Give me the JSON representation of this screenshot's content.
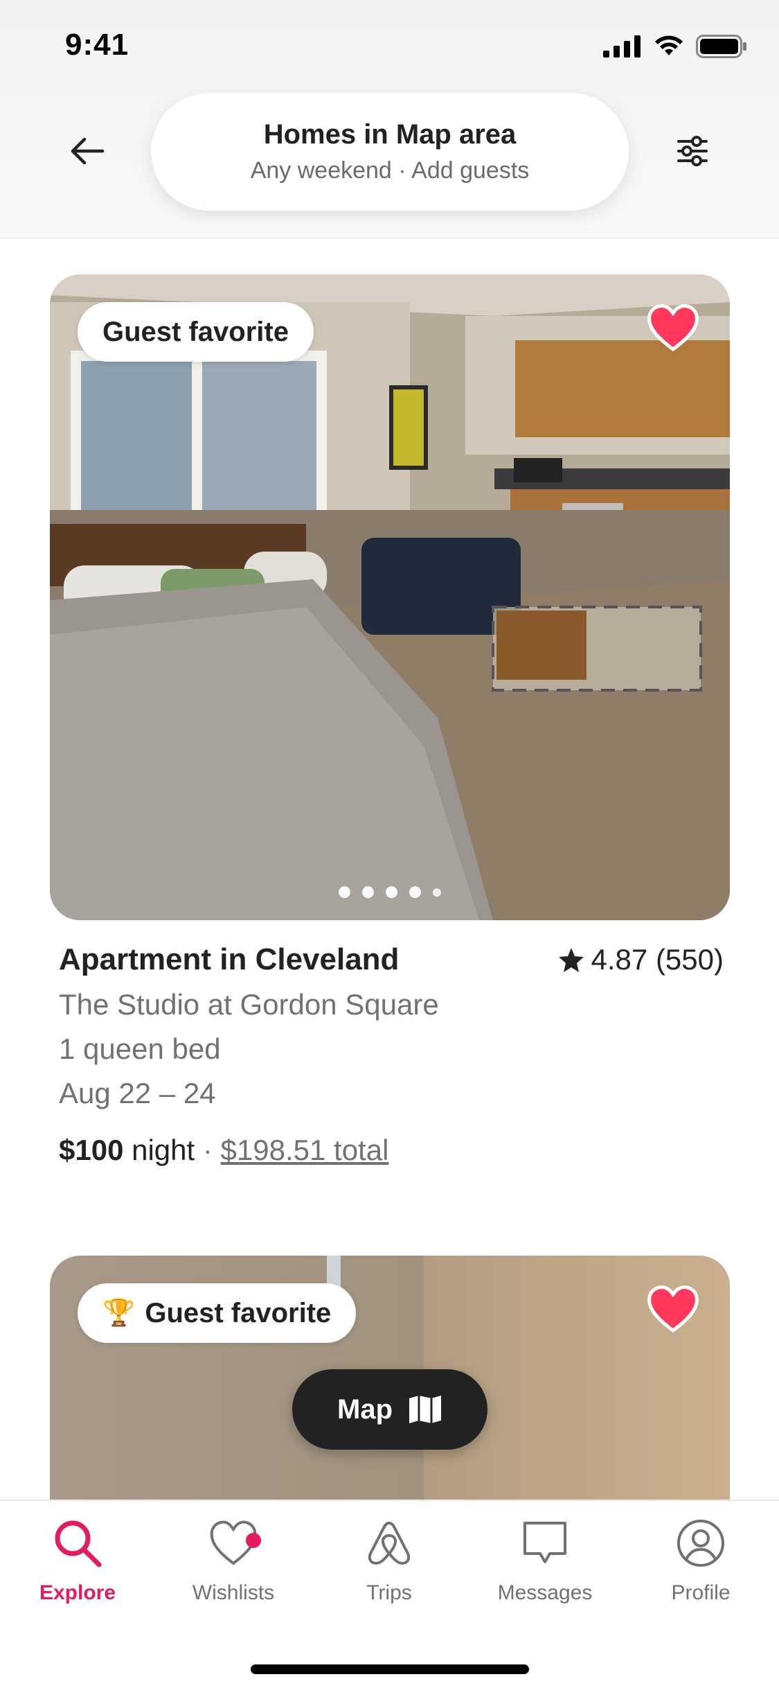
{
  "status_bar": {
    "time": "9:41"
  },
  "header": {
    "search_title": "Homes in Map area",
    "search_subtitle": "Any weekend · Add guests",
    "back_icon": "arrow-left-icon",
    "filter_icon": "sliders-icon"
  },
  "listings": [
    {
      "badge": "Guest favorite",
      "title": "Apartment in Cleveland",
      "rating": "4.87 (550)",
      "subtitle": "The Studio at Gordon Square",
      "beds": "1 queen bed",
      "dates": "Aug 22 – 24",
      "price_amount": "$100",
      "price_unit": "night",
      "price_sep": "·",
      "price_total": "$198.51 total",
      "photo_count": 5,
      "active_photo": 1,
      "saved": true
    },
    {
      "badge": "Guest favorite",
      "badge_icon": "trophy-icon",
      "saved": true
    }
  ],
  "map_button": {
    "label": "Map",
    "icon": "map-icon"
  },
  "tabs": [
    {
      "label": "Explore",
      "icon": "search-icon",
      "active": true
    },
    {
      "label": "Wishlists",
      "icon": "heart-icon",
      "notification": true
    },
    {
      "label": "Trips",
      "icon": "airbnb-logo-icon"
    },
    {
      "label": "Messages",
      "icon": "message-icon"
    },
    {
      "label": "Profile",
      "icon": "profile-icon"
    }
  ],
  "colors": {
    "accent": "#e31c5f",
    "heart": "#ff385c",
    "text": "#222222",
    "muted": "#717171"
  }
}
